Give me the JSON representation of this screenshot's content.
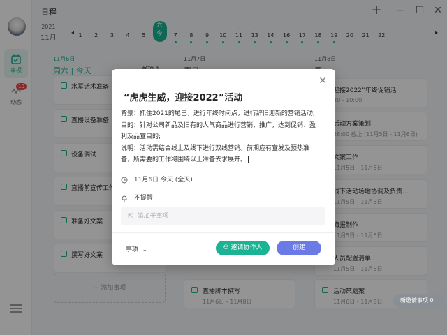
{
  "app": {
    "title": "日程"
  },
  "sidebar": {
    "items": [
      {
        "label": "事项"
      },
      {
        "label": "动态",
        "badge": "10"
      }
    ]
  },
  "datebar": {
    "year": "2021",
    "month": "11月",
    "prev_arrow": "◂",
    "next_arrow": "▸",
    "days": [
      {
        "dash": "-",
        "num": "1",
        "dot": false
      },
      {
        "dash": "-",
        "num": "2",
        "dot": false
      },
      {
        "dash": "-",
        "num": "3",
        "dot": false
      },
      {
        "dash": "-",
        "num": "4",
        "dot": false
      },
      {
        "dash": "-",
        "num": "5",
        "dot": false
      },
      {
        "dash": "六",
        "num": "今",
        "dot": false,
        "today": true
      },
      {
        "dash": "-",
        "num": "7",
        "dot": true
      },
      {
        "dash": "-",
        "num": "8",
        "dot": true
      },
      {
        "dash": "-",
        "num": "9",
        "dot": true
      },
      {
        "dash": "-",
        "num": "10",
        "dot": true
      },
      {
        "dash": "-",
        "num": "11",
        "dot": true
      },
      {
        "dash": "-",
        "num": "13",
        "dot": true
      },
      {
        "dash": "-",
        "num": "14",
        "dot": true
      },
      {
        "dash": "-",
        "num": "16",
        "dot": true
      },
      {
        "dash": "-",
        "num": "17",
        "dot": true
      },
      {
        "dash": "-",
        "num": "18",
        "dot": true
      },
      {
        "dash": "-",
        "num": "19",
        "dot": true
      },
      {
        "dash": "-",
        "num": "20",
        "dot": false
      },
      {
        "dash": "-",
        "num": "21",
        "dot": false
      },
      {
        "dash": "-",
        "num": "22",
        "dot": false
      }
    ]
  },
  "columns": [
    {
      "date": "11月6日",
      "weekday": "周六 | 今天",
      "cards": [
        {
          "title": "水军话术准备"
        },
        {
          "title": "直播设备准备"
        },
        {
          "title": "设备调试"
        },
        {
          "title": "直播前宣传工作"
        },
        {
          "title": "准备好文案"
        },
        {
          "title": "撰写好文案"
        }
      ],
      "add_label": "+ 添加事项"
    },
    {
      "date": "11月7日",
      "weekday": "周日",
      "cards": [
        {
          "title": "直播脚本撰写",
          "sub": "11月6日 - 11月8日"
        }
      ]
    },
    {
      "date": "11月8日",
      "weekday": "周一",
      "cards": [
        {
          "title": "迎接2022”年终促销活",
          "sub": "30 - 10:00"
        },
        {
          "title": "活动方案策划",
          "sub": "28:00 截止 (11月5日 - 11月6日)"
        },
        {
          "title": "文案工作",
          "sub": "11月5日 - 11月6日"
        },
        {
          "title": "线下活动场地协调及负责…",
          "sub": "11月5日 - 11月6日"
        },
        {
          "title": "海报制作",
          "sub": "11月5日 - 11月6日"
        },
        {
          "title": "人员配置清单",
          "sub": "11月5日 - 11月6日"
        },
        {
          "title": "活动策划案",
          "sub": "11月6日 - 11月8日"
        }
      ]
    }
  ],
  "col1_partial": "置顶 1",
  "modal": {
    "title": "“虎虎生威，迎接2022”活动",
    "body": [
      "背景：抓住2021的尾巴，进行年终时间点，进行辞旧迎新的营销活动;",
      "目的：针对公司新品及旧有的人气商品进行营销、推广，达到促销、盈",
      "利及品宣目的;",
      "说明：活动需结合线上及线下进行双线营销。前期应有宣发及预热准",
      "备，所需要的工作将围绕以上准备去求展开。"
    ],
    "date_text": "11月6日 今天 (全天)",
    "remind_text": "不提醒",
    "subtask_placeholder": "添加子事项",
    "type_label": "事项",
    "invite_label": "邀请协作人",
    "create_label": "创建"
  },
  "new_invite": "新邀请事项 0",
  "colors": {
    "accent": "#1bb394",
    "create": "#6a7be8"
  }
}
